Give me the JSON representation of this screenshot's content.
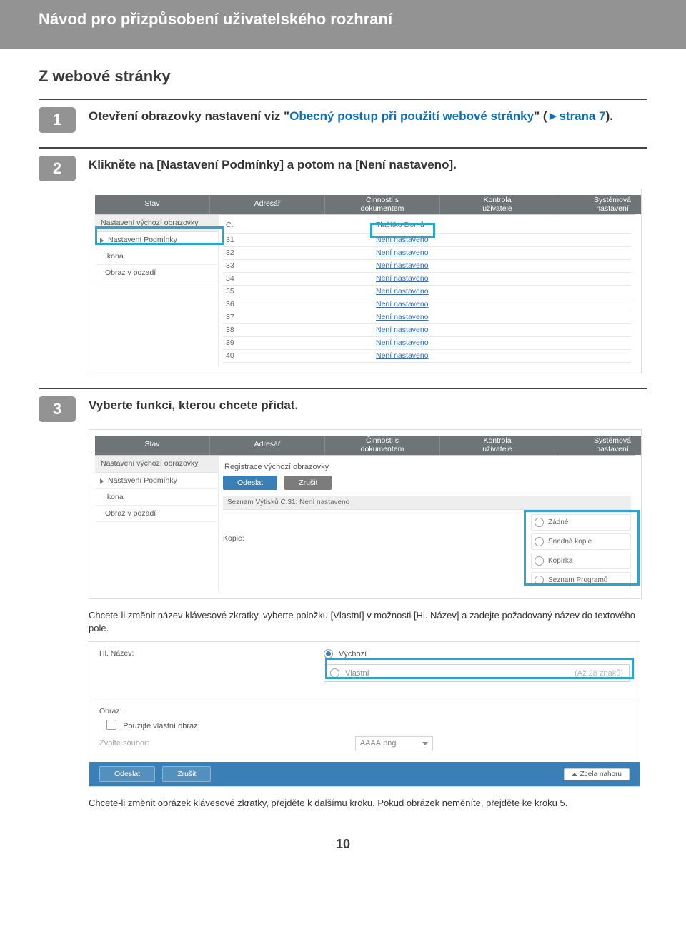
{
  "header": {
    "title": "Návod pro přizpůsobení uživatelského rozhraní"
  },
  "section_title": "Z webové stránky",
  "steps": {
    "s1": {
      "num": "1",
      "pre": "Otevření obrazovky nastavení viz \"",
      "link1": "Obecný postup při použití webové stránky",
      "mid": "\" (",
      "triangle": "►",
      "link2": "strana 7",
      "post": ")."
    },
    "s2": {
      "num": "2",
      "text": "Klikněte na [Nastavení Podmínky] a potom na [Není nastaveno]."
    },
    "s3": {
      "num": "3",
      "text": "Vyberte funkci, kterou chcete přidat."
    }
  },
  "shot_common": {
    "tabs": {
      "stav": "Stav",
      "adresar": "Adresář",
      "cinnosti_l1": "Činnosti s",
      "cinnosti_l2": "dokumentem",
      "kontrola_l1": "Kontrola",
      "kontrola_l2": "uživatele",
      "system_l1": "Systémová",
      "system_l2": "nastavení"
    },
    "side": {
      "head": "Nastavení výchozí obrazovky",
      "podm": "Nastavení Podmínky",
      "ikona": "Ikona",
      "obraz": "Obraz v pozadí"
    }
  },
  "shot1": {
    "th_num": "Č.",
    "th_btn": "Tlačítko Domů",
    "rows": [
      {
        "n": "31",
        "v": "Není nastaveno"
      },
      {
        "n": "32",
        "v": "Není nastaveno"
      },
      {
        "n": "33",
        "v": "Není nastaveno"
      },
      {
        "n": "34",
        "v": "Není nastaveno"
      },
      {
        "n": "35",
        "v": "Není nastaveno"
      },
      {
        "n": "36",
        "v": "Není nastaveno"
      },
      {
        "n": "37",
        "v": "Není nastaveno"
      },
      {
        "n": "38",
        "v": "Není nastaveno"
      },
      {
        "n": "39",
        "v": "Není nastaveno"
      },
      {
        "n": "40",
        "v": "Není nastaveno"
      }
    ]
  },
  "shot2": {
    "panel_title": "Registrace výchozí obrazovky",
    "btn_send": "Odeslat",
    "btn_cancel": "Zrušit",
    "sub_hd": "Seznam Výtisků Č.31: Není nastaveno",
    "row_label": "Kopie:",
    "opts": {
      "none": "Žádné",
      "easy": "Snadná kopie",
      "copier": "Kopírka",
      "programs": "Seznam Programů"
    }
  },
  "para1": "Chcete-li změnit název klávesové zkratky, vyberte položku [Vlastní] v možnosti [Hl. Název] a zadejte požadovaný název do textového pole.",
  "shot3": {
    "label": "Hl. Název:",
    "vychozi": "Výchozí",
    "vlastni": "Vlastní",
    "hint": "(Až 28 znaků)",
    "obraz_label": "Obraz:",
    "use_custom": "Použijte vlastní obraz",
    "choose_file": "Zvolte soubor:",
    "filename": "AAAA.png",
    "btn_send": "Odeslat",
    "btn_cancel": "Zrušit",
    "top": "Zcela nahoru"
  },
  "para2": "Chcete-li změnit obrázek klávesové zkratky, přejděte k dalšímu kroku. Pokud obrázek neměníte, přejděte ke kroku 5.",
  "page_number": "10"
}
